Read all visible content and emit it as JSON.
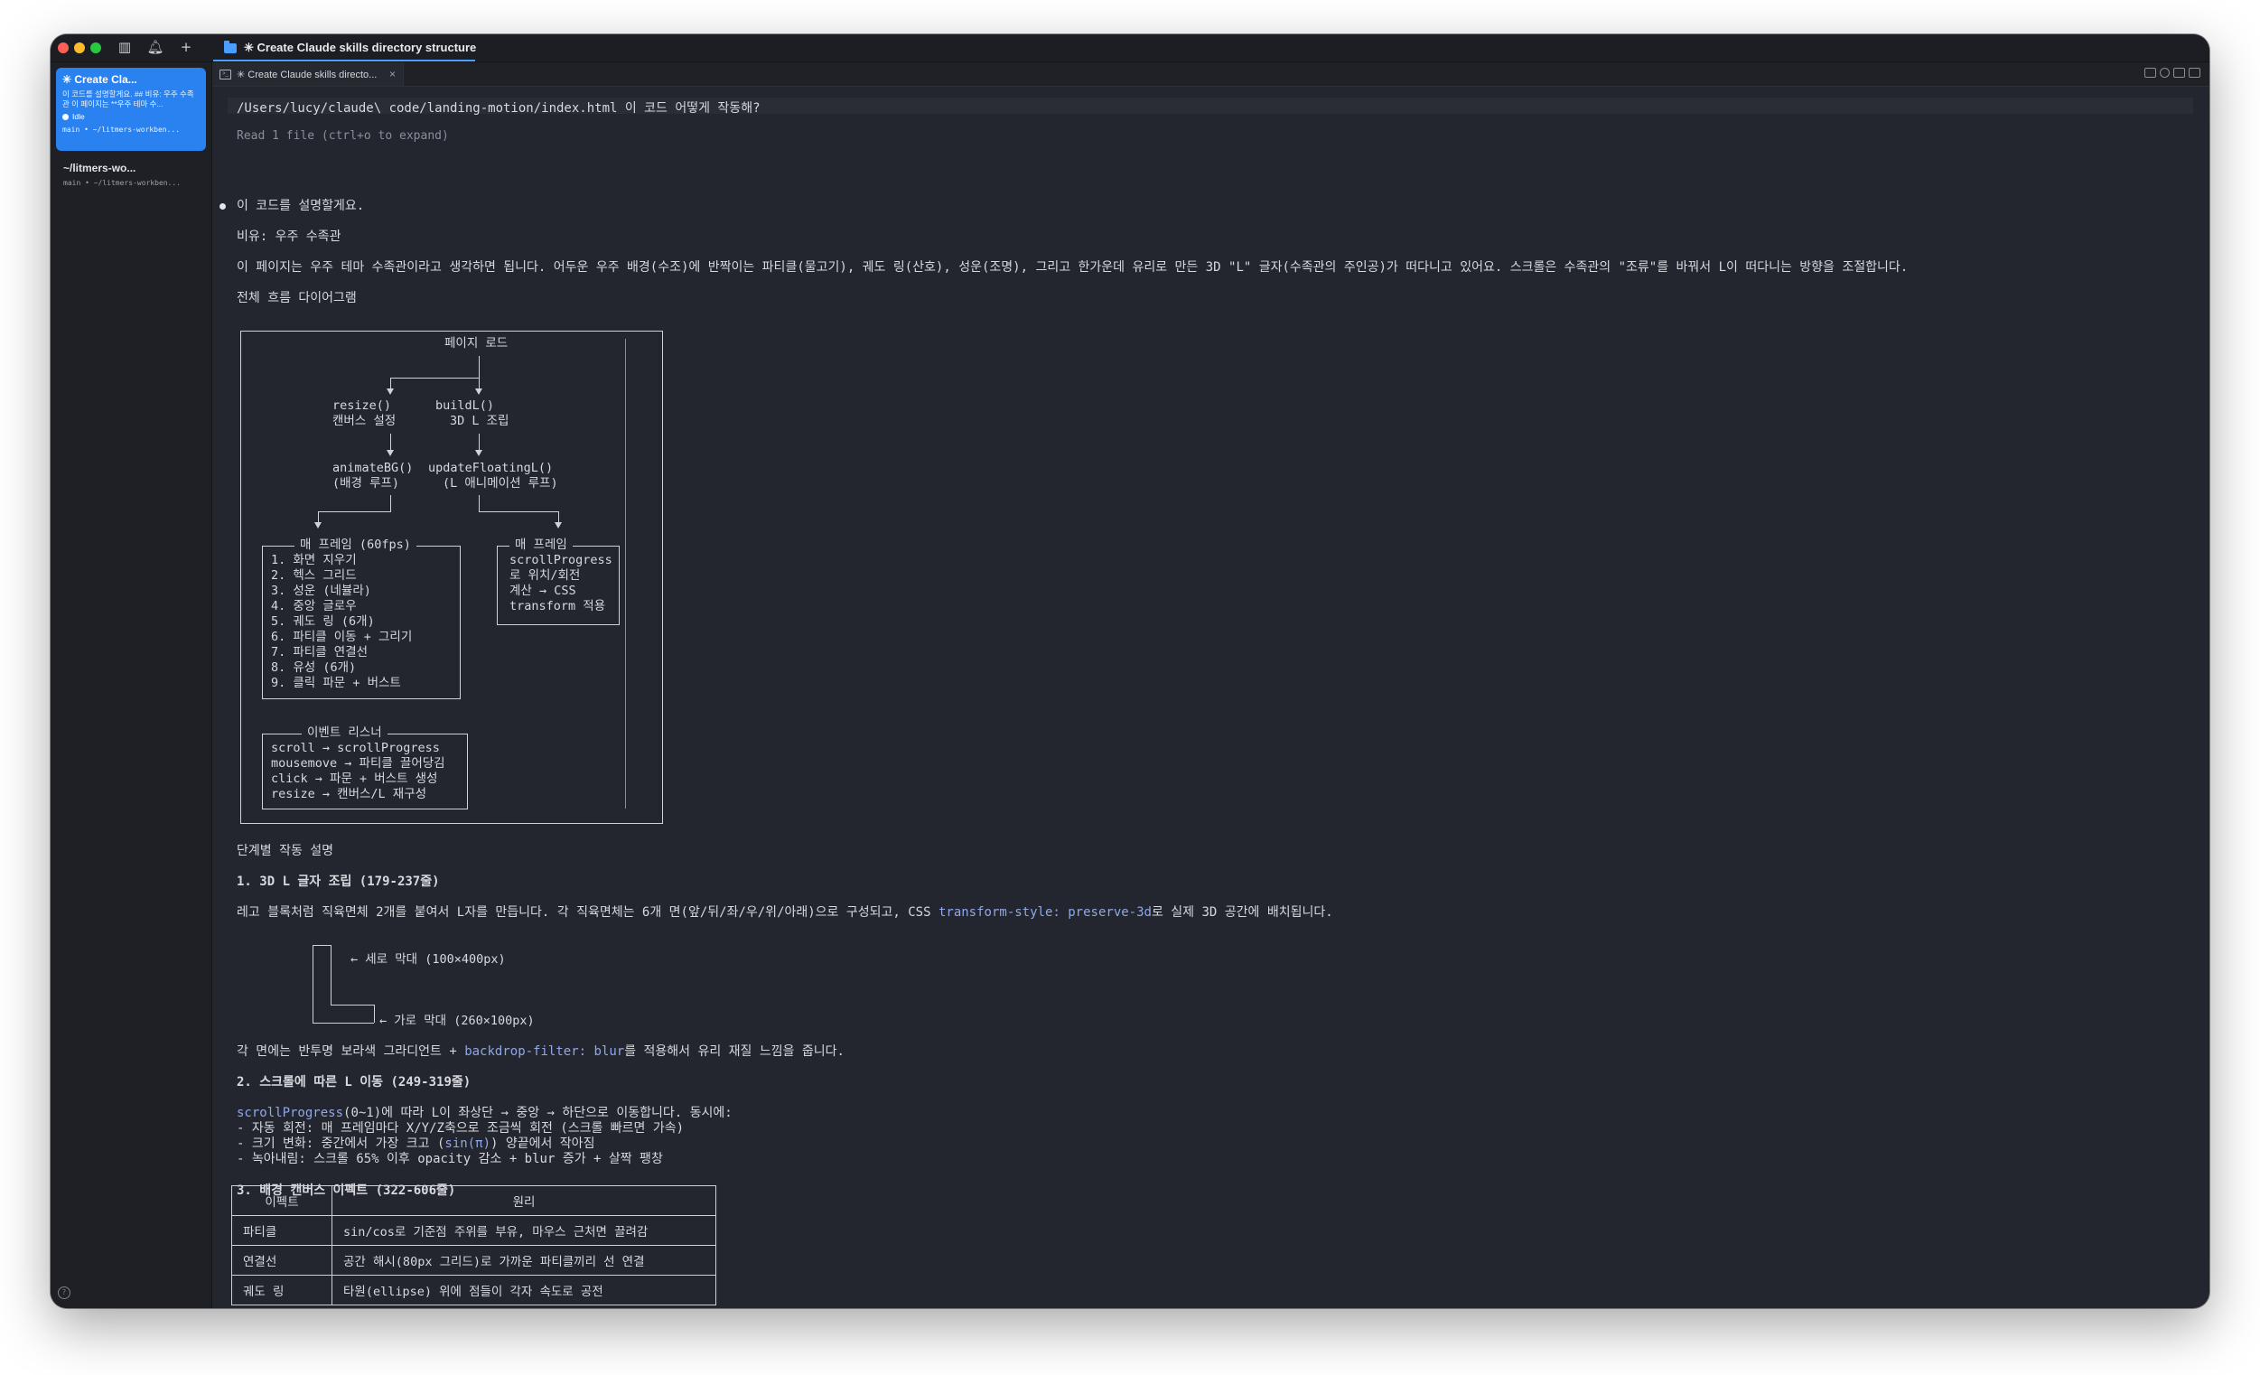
{
  "window": {
    "title": "✳ Create Claude skills directory structure",
    "tab_label": "✳ Create Claude skills directo...",
    "tab_close": "×"
  },
  "sidebar": {
    "active_session": {
      "title": "✳ Create Cla...",
      "preview": "이 코드를 설명할게요. ## 비유: 우주 수족관 이 페이지는 **우주 테마 수...",
      "status": "Idle",
      "meta": "main • ~/litmers-workben..."
    },
    "group": {
      "title": "~/litmers-wo...",
      "meta": "main • ~/litmers-workben..."
    }
  },
  "content": {
    "command": "/Users/lucy/claude\\ code/landing-motion/index.html 이 코드 어떻게 작동해?",
    "read_note": "Read 1 file (ctrl+o to expand)",
    "intro": "이 코드를 설명할게요.",
    "metaphor": "비유: 우주 수족관",
    "description": "이 페이지는 우주 테마 수족관이라고 생각하면 됩니다. 어두운 우주 배경(수조)에 반짝이는 파티클(물고기), 궤도 링(산호), 성운(조명), 그리고 한가운데 유리로 만든 3D \"L\" 글자(수족관의 주인공)가 떠다니고 있어요. 스크롤은 수족관의 \"조류\"를 바꿔서 L이 떠다니는 방향을 조절합니다.",
    "diagram_heading": "전체 흐름 다이어그램",
    "diagram": {
      "page_load": "페이지 로드",
      "resize": "resize()",
      "resize_desc": "캔버스 설정",
      "buildL": "buildL()",
      "buildL_desc": "3D L 조립",
      "animateBG": "animateBG()",
      "animateBG_desc": "(배경 루프)",
      "updateFloating": "updateFloatingL()",
      "updateFloating_desc": "(L 애니메이션 루프)",
      "frame_left_title": "매 프레임 (60fps)",
      "frame_left_items": [
        "1. 화면 지우기",
        "2. 헥스 그리드",
        "3. 성운 (네뷸라)",
        "4. 중앙 글로우",
        "5. 궤도 링 (6개)",
        "6. 파티클 이동 + 그리기",
        "7. 파티클 연결선",
        "8. 유성 (6개)",
        "9. 클릭 파문 + 버스트"
      ],
      "frame_right_title": "매 프레임",
      "frame_right_items": [
        "scrollProgress",
        "로 위치/회전",
        "계산 → CSS",
        "transform 적용"
      ],
      "events_title": "이벤트 리스너",
      "events_items": [
        "scroll → scrollProgress",
        "mousemove → 파티클 끌어당김",
        "click → 파문 + 버스트 생성",
        "resize → 캔버스/L 재구성"
      ]
    },
    "steps_heading": "단계별 작동 설명",
    "step1_title": "1. 3D L 글자 조립 (179-237줄)",
    "step1_text_a": "레고 블록처럼 직육면체 2개를 붙여서 L자를 만듭니다. 각 직육면체는 6개 면(앞/뒤/좌/우/위/아래)으로 구성되고, CSS ",
    "step1_code": "transform-style: preserve-3d",
    "step1_text_b": "로 실제 3D 공간에 배치됩니다.",
    "l_vertical": "← 세로 막대 (100×400px)",
    "l_horizontal": "← 가로 막대 (260×100px)",
    "faces_text_a": "각 면에는 반투명 보라색 그라디언트 + ",
    "faces_code": "backdrop-filter: blur",
    "faces_text_b": "를 적용해서 유리 재질 느낌을 줍니다.",
    "step2_title": "2. 스크롤에 따른 L 이동 (249-319줄)",
    "step2_code": "scrollProgress",
    "step2_line1": "(0~1)에 따라 L이 좌상단 → 중앙 → 하단으로 이동합니다. 동시에:",
    "step2_line2": "- 자동 회전: 매 프레임마다 X/Y/Z축으로 조금씩 회전 (스크롤 빠르면 가속)",
    "step2_line3_a": "- 크기 변화: 중간에서 가장 크고 (",
    "step2_line3_code": "sin(π)",
    "step2_line3_b": ") 양끝에서 작아짐",
    "step2_line4": "- 녹아내림: 스크롤 65% 이후 opacity 감소 + blur 증가 + 살짝 팽창",
    "step3_title": "3. 배경 캔버스 이펙트 (322-606줄)",
    "table": {
      "headers": [
        "이펙트",
        "원리"
      ],
      "rows": [
        [
          "파티클",
          "sin/cos로 기준점 주위를 부유, 마우스 근처면 끌려감"
        ],
        [
          "연결선",
          "공간 해시(80px 그리드)로 가까운 파티클끼리 선 연결"
        ],
        [
          "궤도 링",
          "타원(ellipse) 위에 점들이 각자 속도로 공전"
        ]
      ]
    }
  }
}
